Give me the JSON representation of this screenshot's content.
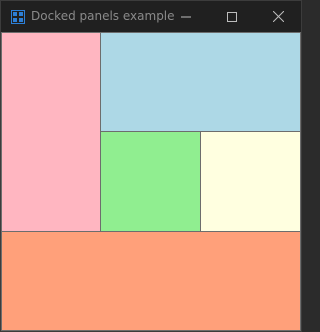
{
  "window": {
    "title": "Docked panels example",
    "icon": "app-window-icon"
  },
  "caption_buttons": {
    "minimize": "minimize-icon",
    "maximize": "maximize-icon",
    "close": "close-icon"
  },
  "panels": [
    {
      "name": "left",
      "dock": "left",
      "color": "#ffb6c1"
    },
    {
      "name": "top",
      "dock": "top",
      "color": "#add8e6"
    },
    {
      "name": "center-left",
      "dock": "left",
      "color": "#90ee90"
    },
    {
      "name": "center-fill",
      "dock": "fill",
      "color": "#ffffe0"
    },
    {
      "name": "bottom",
      "dock": "bottom",
      "color": "#ffa07a"
    }
  ],
  "colors": {
    "titlebar": "#202020",
    "title_text": "#8a8a8a",
    "accent": "#2d7fd6",
    "panel_border": "#6d6d6d"
  }
}
